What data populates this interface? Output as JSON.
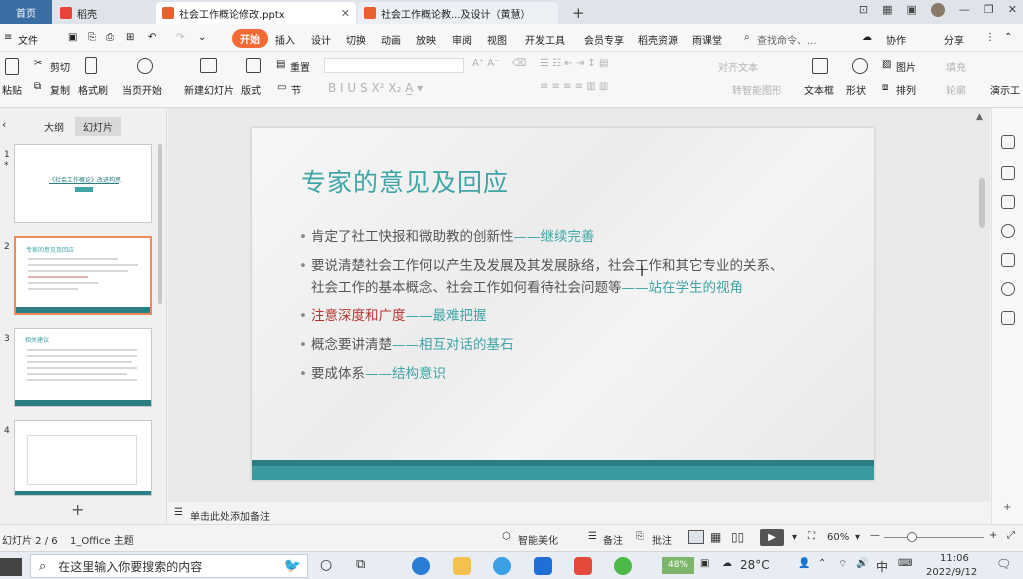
{
  "tabs": {
    "home": "首页",
    "daoke": "稻壳",
    "file1": "社会工作概论修改.pptx",
    "file2": "社会工作概论教...及设计（黄慧）",
    "add": "+"
  },
  "menu": {
    "file": "文件",
    "start": "开始",
    "items": [
      "插入",
      "设计",
      "切换",
      "动画",
      "放映",
      "审阅",
      "视图",
      "开发工具",
      "会员专享",
      "稻壳资源",
      "雨课堂"
    ],
    "search": "查找命令、...",
    "collab": "协作",
    "share": "分享"
  },
  "ribbon": {
    "paste": "粘贴",
    "cut": "剪切",
    "copy": "复制",
    "format_painter": "格式刷",
    "from_current": "当页开始",
    "new_slide": "新建幻灯片",
    "layout": "版式",
    "section": "节",
    "reset": "重置",
    "align_text": "对齐文本",
    "convert_smartart": "转智能图形",
    "textbox": "文本框",
    "shape": "形状",
    "picture": "图片",
    "fill": "填充",
    "arrange": "排列",
    "outline": "轮廓",
    "present": "演示工"
  },
  "panel": {
    "outline_tab": "大纲",
    "slides_tab": "幻灯片",
    "slides": [
      {
        "num": "1",
        "title": "《社会工作概论》改进构思"
      },
      {
        "num": "2",
        "title": "专家的意见及回应"
      },
      {
        "num": "3",
        "title": "相关建议"
      },
      {
        "num": "4",
        "title": ""
      }
    ],
    "add": "+"
  },
  "slide": {
    "title": "专家的意见及回应",
    "bullets": [
      {
        "text": "肯定了社工快报和微助教的创新性",
        "dash": "——",
        "tail": "继续完善"
      },
      {
        "text": "要说清楚社会工作何以产生及发展及其发展脉络，社会工作和其它专业的关系、",
        "dash": "",
        "tail": ""
      },
      {
        "text": "社会工作的基本概念、社会工作如何看待社会问题等",
        "dash": "——",
        "tail": "站在学生的视角"
      },
      {
        "text": "注意深度和广度",
        "dash": "——",
        "tail": "最难把握"
      },
      {
        "text": "概念要讲清楚",
        "dash": "——",
        "tail": "相互对话的基石"
      },
      {
        "text": "要成体系",
        "dash": "——",
        "tail": "结构意识"
      }
    ]
  },
  "notes": "单击此处添加备注",
  "status": {
    "slide_info": "幻灯片 2 / 6",
    "theme": "1_Office 主题",
    "smart": "智能美化",
    "notes": "备注",
    "comment": "批注",
    "zoom": "60%"
  },
  "taskbar": {
    "search_placeholder": "在这里输入你要搜索的内容",
    "battery": "48%",
    "weather": "28°C",
    "ime": "中",
    "time": "11:06",
    "date": "2022/9/12"
  },
  "colors": {
    "accent": "#3fa5a6",
    "red": "#b3352f",
    "start": "#f26b36"
  }
}
